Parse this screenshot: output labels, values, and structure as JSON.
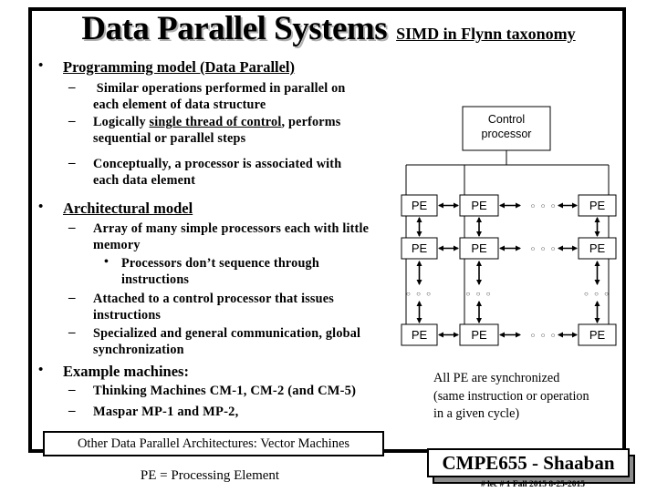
{
  "slide": {
    "title": "Data Parallel Systems",
    "subtitle": "SIMD in Flynn taxonomy",
    "bullets": [
      {
        "heading": "Programming model  (Data Parallel)",
        "items": [
          {
            "lines": [
              " Similar operations performed in parallel on",
              "each element of data structure"
            ]
          },
          {
            "pre": "Logically ",
            "underlined": "single thread of control",
            "post": ", performs",
            "line2": "sequential or parallel steps"
          },
          {
            "lines": [
              "Conceptually, a processor is associated with",
              "each data element"
            ]
          }
        ]
      },
      {
        "heading": "Architectural model",
        "items": [
          {
            "lines": [
              "Array of many simple processors each with little",
              "memory"
            ],
            "subitems": [
              {
                "lines": [
                  "Processors don’t sequence through",
                  "instructions"
                ]
              }
            ]
          },
          {
            "lines": [
              "Attached to a control processor that issues",
              "instructions"
            ]
          },
          {
            "lines": [
              "Specialized and general communication,  global",
              "synchronization"
            ]
          }
        ]
      },
      {
        "heading": "Example machines:",
        "items": [
          {
            "lines": [
              "Thinking Machines CM-1, CM-2 (and CM-5)"
            ]
          },
          {
            "lines": [
              "Maspar MP-1 and MP-2,"
            ]
          }
        ]
      }
    ],
    "bullet_glyph": "•",
    "dash_glyph": "–",
    "note_lines": [
      "All PE are synchronized",
      "(same instruction or operation",
      "in a given cycle)"
    ],
    "other_box": "Other Data Parallel Architectures: Vector Machines",
    "pe_definition": "PE = Processing Element",
    "badge": "CMPE655 - Shaaban",
    "lecture_info": "#  lec # 1   Fall 2015   8-25-2015"
  },
  "diagram": {
    "control_label_lines": [
      "Control",
      "processor"
    ],
    "pe_label": "PE",
    "ellipsis": "○ ○ ○",
    "grid_rows": [
      "row-1",
      "row-2",
      "row-n"
    ],
    "grid_cols": [
      "col-1",
      "col-2",
      "col-n"
    ]
  }
}
